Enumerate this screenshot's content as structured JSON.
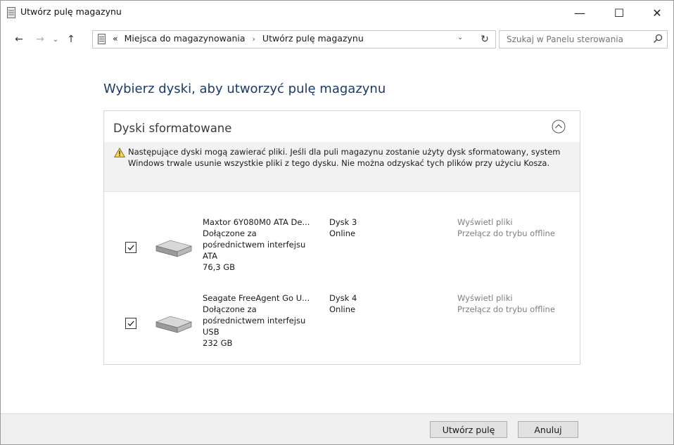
{
  "window": {
    "title": "Utwórz pulę magazynu",
    "minimize": "—",
    "maximize": "☐",
    "close": "✕"
  },
  "nav": {
    "back": "←",
    "forward": "→",
    "recent": "⌄",
    "up": "↑",
    "breadcrumb_prefix": "«",
    "breadcrumbs": [
      "Miejsca do magazynowania",
      "Utwórz pulę magazynu"
    ],
    "breadcrumb_sep": "›",
    "dropdown": "⌄",
    "refresh": "↻",
    "search_placeholder": "Szukaj w Panelu sterowania"
  },
  "main": {
    "heading": "Wybierz dyski, aby utworzyć pulę magazynu",
    "panel": {
      "title": "Dyski sformatowane",
      "warning": "Następujące dyski mogą zawierać pliki. Jeśli dla puli magazynu zostanie użyty dysk sformatowany, system Windows trwale usunie wszystkie pliki z tego dysku. Nie można odzyskać tych plików przy użyciu Kosza.",
      "disks": [
        {
          "checked": true,
          "name": "Maxtor 6Y080M0 ATA De...",
          "conn1": "Dołączone za",
          "conn2": "pośrednictwem interfejsu",
          "bus": "ATA",
          "size": "76,3 GB",
          "number": "Dysk 3",
          "status": "Online",
          "link_view": "Wyświetl pliki",
          "link_offline": "Przełącz do trybu offline"
        },
        {
          "checked": true,
          "name": "Seagate FreeAgent Go U...",
          "conn1": "Dołączone za",
          "conn2": "pośrednictwem interfejsu",
          "bus": "USB",
          "size": "232 GB",
          "number": "Dysk 4",
          "status": "Online",
          "link_view": "Wyświetl pliki",
          "link_offline": "Przełącz do trybu offline"
        }
      ]
    }
  },
  "footer": {
    "create_label": "Utwórz pulę",
    "cancel_label": "Anuluj"
  },
  "icons": {
    "app": "storage-icon",
    "address": "storage-icon",
    "search": "search-icon",
    "warning": "warning-icon",
    "collapse": "chevron-up-icon",
    "drive": "hard-drive-icon",
    "check": "checkmark-icon"
  },
  "colors": {
    "heading": "#1a3a6b",
    "link_gray": "#808080",
    "footer_bg": "#f0f0f0",
    "warning_bg": "#f2f2f2"
  }
}
